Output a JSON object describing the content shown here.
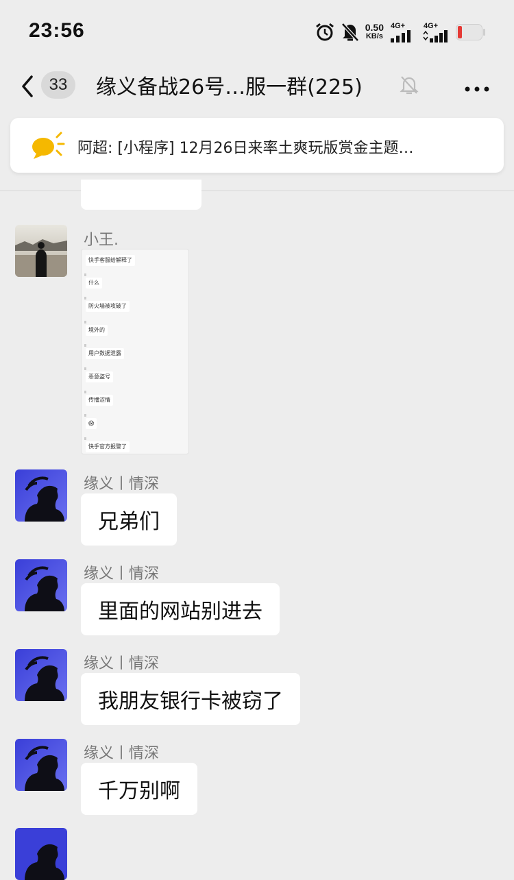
{
  "status_bar": {
    "time": "23:56",
    "net_speed_value": "0.50",
    "net_speed_unit": "KB/s",
    "sim1_label": "4G+",
    "sim2_label": "4G+",
    "icons": [
      "alarm-icon",
      "mute-icon",
      "signal-icon",
      "signal-icon",
      "battery-low-icon"
    ]
  },
  "header": {
    "back_icon": "chevron-left-icon",
    "unread_count": "33",
    "title": "缘义备战26号…服一群(225)",
    "muted_icon": "bell-off-icon",
    "more_icon": "more-icon"
  },
  "pinned_notice": {
    "icon": "megaphone-bubble-icon",
    "text": "阿超: [小程序] 12月26日来率土爽玩版赏金主题…"
  },
  "messages": [
    {
      "sender": "小王.",
      "type": "image",
      "image_lines": [
        "快手客服给解释了",
        "什么",
        "防火墙被攻破了",
        "境外的",
        "用户数据泄露",
        "恶意盗号",
        "传播涩情",
        "😱",
        "快手官方报警了"
      ]
    },
    {
      "sender": "缘义丨情深",
      "type": "text",
      "text": "兄弟们"
    },
    {
      "sender": "缘义丨情深",
      "type": "text",
      "text": "里面的网站别进去"
    },
    {
      "sender": "缘义丨情深",
      "type": "text",
      "text": "我朋友银行卡被窃了"
    },
    {
      "sender": "缘义丨情深",
      "type": "text",
      "text": "千万别啊"
    }
  ],
  "colors": {
    "background": "#ededed",
    "bubble": "#ffffff",
    "battery_low": "#e53935",
    "notice_icon": "#f5b800"
  }
}
